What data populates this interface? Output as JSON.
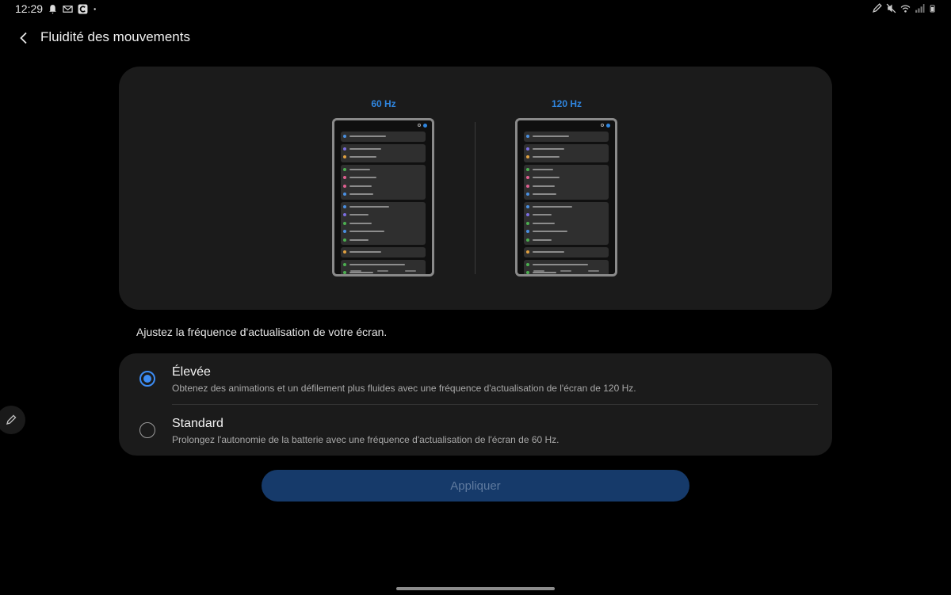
{
  "status_bar": {
    "time": "12:29",
    "left_icons": [
      "bell-icon",
      "outlook-icon",
      "c-app-icon",
      "dot-icon"
    ],
    "right_icons": [
      "pen-icon",
      "mute-icon",
      "wifi-icon",
      "signal-icon",
      "battery-icon"
    ]
  },
  "header": {
    "title": "Fluidité des mouvements",
    "back_icon": "chevron-left-icon"
  },
  "preview": {
    "label_60": "60 Hz",
    "label_120": "120 Hz"
  },
  "description": "Ajustez la fréquence d'actualisation de votre écran.",
  "options": [
    {
      "title": "Élevée",
      "description": "Obtenez des animations et un défilement plus fluides avec une fréquence d'actualisation de l'écran de 120 Hz.",
      "selected": true
    },
    {
      "title": "Standard",
      "description": "Prolongez l'autonomie de la batterie avec une fréquence d'actualisation de l'écran de 60 Hz.",
      "selected": false
    }
  ],
  "apply_label": "Appliquer",
  "colors": {
    "accent": "#3c8cf3",
    "hz_label": "#2f86e0",
    "card": "#1b1b1b",
    "apply_bg": "#163a6a"
  }
}
